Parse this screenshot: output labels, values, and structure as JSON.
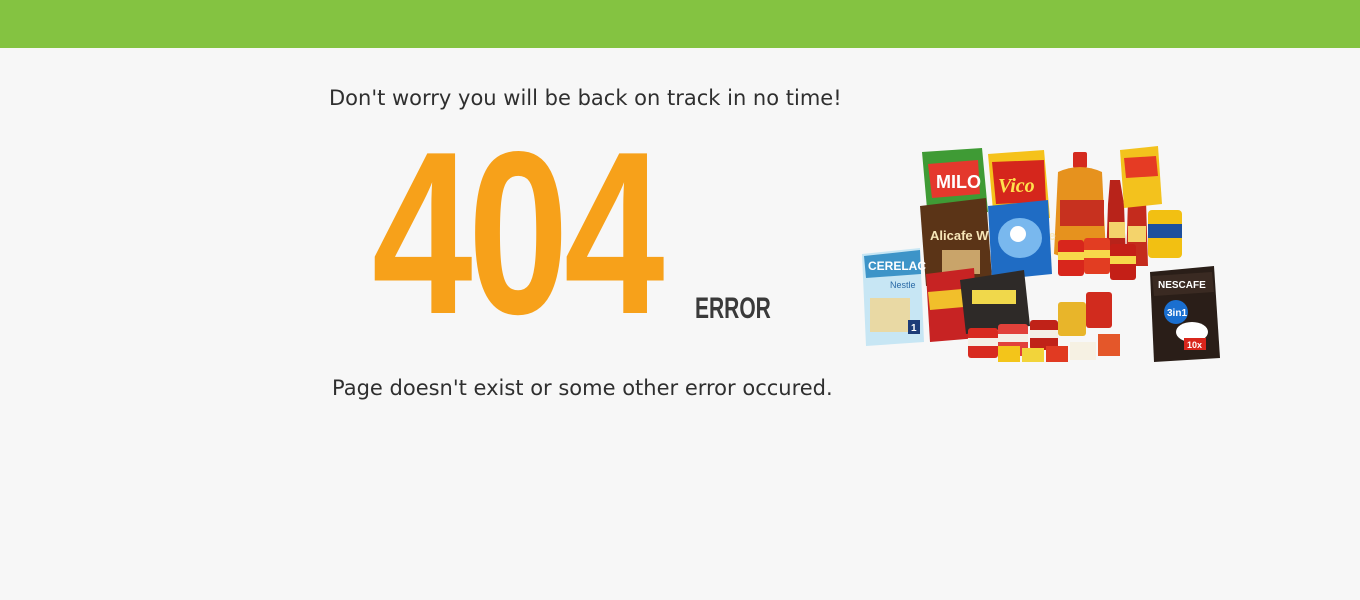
{
  "header": {
    "bar_color": "#84c341"
  },
  "error_page": {
    "tagline": "Don't worry you will be back on track in no time!",
    "code": "404",
    "code_color": "#f7a11a",
    "code_suffix": "ERROR",
    "message": "Page doesn't exist or some other error occured."
  },
  "illustration": {
    "subject": "groceries-product-collage",
    "product_labels": [
      "MILO",
      "Vico",
      "Alicafe White Coffee",
      "CERELAC",
      "Nestle",
      "NESCAFE",
      "3in1",
      "10x",
      "1"
    ]
  }
}
